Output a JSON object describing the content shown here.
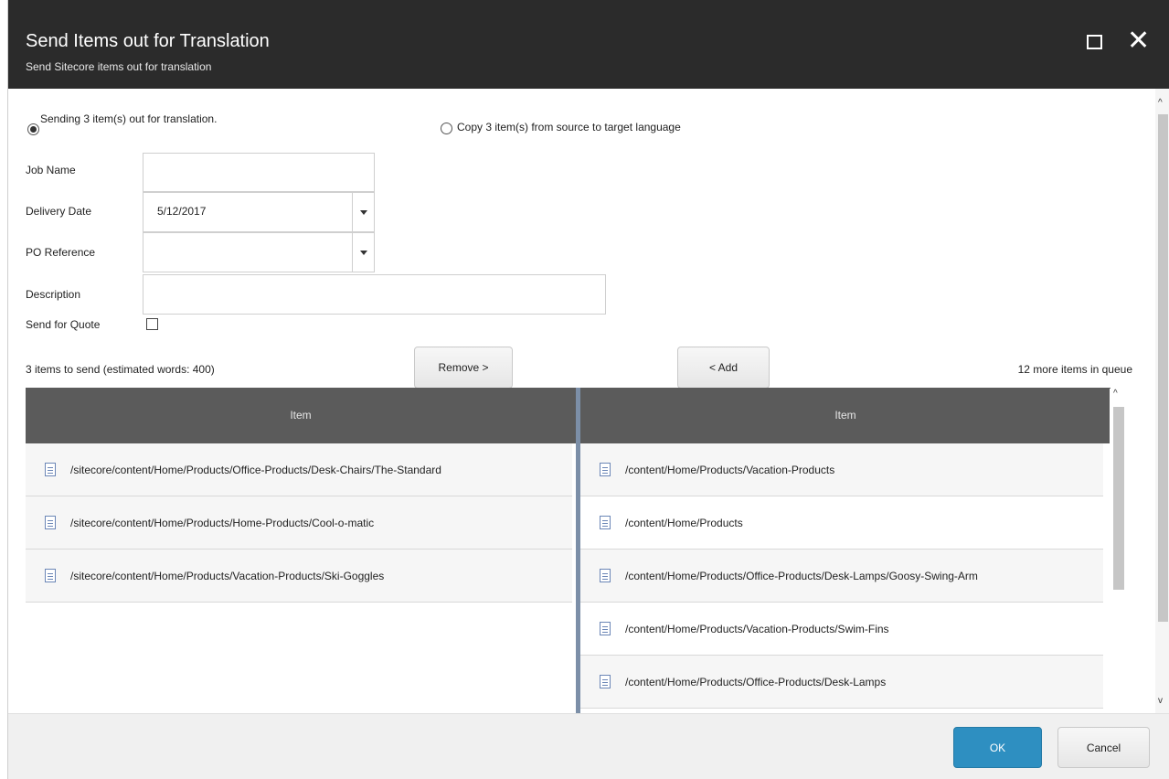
{
  "window": {
    "title": "Send Items out for Translation",
    "subtitle": "Send Sitecore items out for translation",
    "controls": {
      "maximize_icon": "maximize-icon",
      "close_icon": "close-icon",
      "close_glyph": "✕"
    }
  },
  "options": {
    "send_label": "Sending 3 item(s) out for translation.",
    "send_selected": true,
    "copy_label": "Copy 3 item(s) from source to target language",
    "copy_selected": false
  },
  "form": {
    "job_name": {
      "label": "Job Name",
      "value": ""
    },
    "delivery_date": {
      "label": "Delivery Date",
      "value": "5/12/2017"
    },
    "po_reference": {
      "label": "PO Reference",
      "value": ""
    },
    "description": {
      "label": "Description",
      "value": ""
    },
    "send_for_quote": {
      "label": "Send for Quote",
      "checked": false
    }
  },
  "transfer": {
    "left_status": "3 items to send (estimated words: 400)",
    "remove_label": "Remove >",
    "add_label": "< Add",
    "right_status": "12 more items in queue"
  },
  "left_grid": {
    "header": "Item",
    "rows": [
      "/sitecore/content/Home/Products/Office-Products/Desk-Chairs/The-Standard",
      "/sitecore/content/Home/Products/Home-Products/Cool-o-matic",
      "/sitecore/content/Home/Products/Vacation-Products/Ski-Goggles"
    ]
  },
  "right_grid": {
    "header": "Item",
    "rows": [
      "/content/Home/Products/Vacation-Products",
      "/content/Home/Products",
      "/content/Home/Products/Office-Products/Desk-Lamps/Goosy-Swing-Arm",
      "/content/Home/Products/Vacation-Products/Swim-Fins",
      "/content/Home/Products/Office-Products/Desk-Lamps"
    ]
  },
  "footer": {
    "ok_label": "OK",
    "cancel_label": "Cancel"
  },
  "scroll": {
    "up_glyph": "^",
    "down_glyph": "v"
  },
  "colors": {
    "titlebar": "#2b2b2b",
    "grid_header": "#5b5b5b",
    "ok_button": "#2e8fc1",
    "splitter": "#7c8fa8"
  }
}
